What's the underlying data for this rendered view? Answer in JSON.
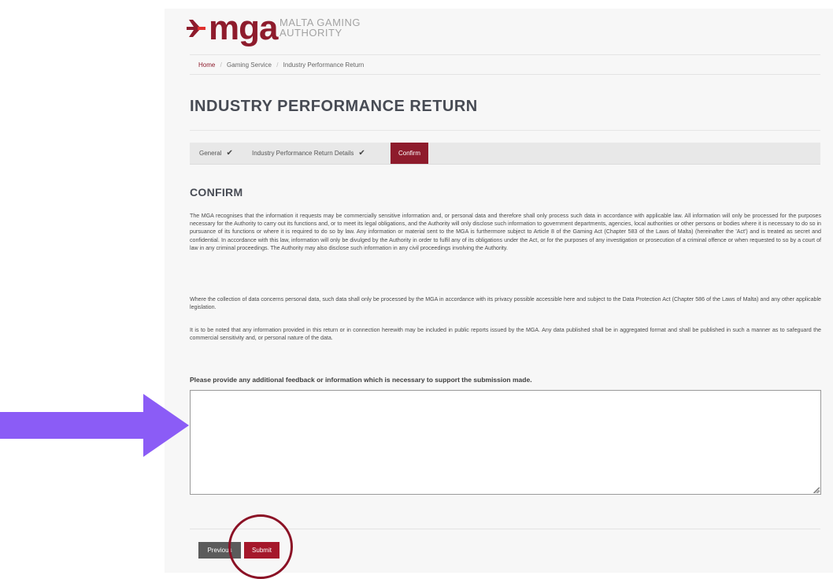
{
  "header": {
    "logo_text": "mga",
    "logo_sub_line1": "MALTA GAMING",
    "logo_sub_line2": "AUTHORITY"
  },
  "breadcrumb": {
    "items": [
      "Home",
      "Gaming Service",
      "Industry Performance Return"
    ],
    "separator": "/"
  },
  "page": {
    "title": "INDUSTRY PERFORMANCE RETURN"
  },
  "steps": [
    {
      "label": "General",
      "state": "done"
    },
    {
      "label": "Industry Performance Return Details",
      "state": "done"
    },
    {
      "label": "Confirm",
      "state": "active"
    }
  ],
  "confirm": {
    "heading": "CONFIRM",
    "paragraphs": [
      "The MGA recognises that the information it requests may be commercially sensitive information and, or personal data and therefore shall only process such data in accordance with applicable law. All information will only be processed for the purposes necessary for the Authority to carry out its functions and, or to meet its legal obligations, and the Authority will only disclose such information to government departments, agencies, local authorities or other persons or bodies where it is necessary to do so in pursuance of its functions or where it is required to do so by law. Any information or material sent to the MGA is furthermore subject to Article 8 of the Gaming Act (Chapter 583 of the Laws of Malta) (hereinafter the 'Act') and is treated as secret and confidential. In accordance with this law, information will only be divulged by the Authority in order to fulfil any of its obligations under the Act, or for the purposes of any investigation or prosecution of a criminal offence or when requested to so by a court of law in any criminal proceedings. The Authority may also disclose such information in any civil proceedings involving the Authority.",
      "Where the collection of data concerns personal data, such data shall only be processed by the MGA in accordance with its privacy possible accessible here and subject to the Data Protection Act (Chapter 586 of the Laws of Malta) and any other applicable legislation.",
      "It is to be noted that any information provided in this return or in connection herewith may be included in public reports issued by the MGA. Any data published shall be in aggregated format and shall be published in such a manner as to safeguard the commercial sensitivity and, or personal nature of the data."
    ]
  },
  "feedback": {
    "label": "Please provide any additional feedback or information which is necessary to support the submission made.",
    "value": ""
  },
  "actions": {
    "previous_label": "Previous",
    "submit_label": "Submit"
  },
  "colors": {
    "brand": "#8e1b2c",
    "annotation_arrow": "#8b5cf6",
    "annotation_circle": "#8b1125"
  }
}
